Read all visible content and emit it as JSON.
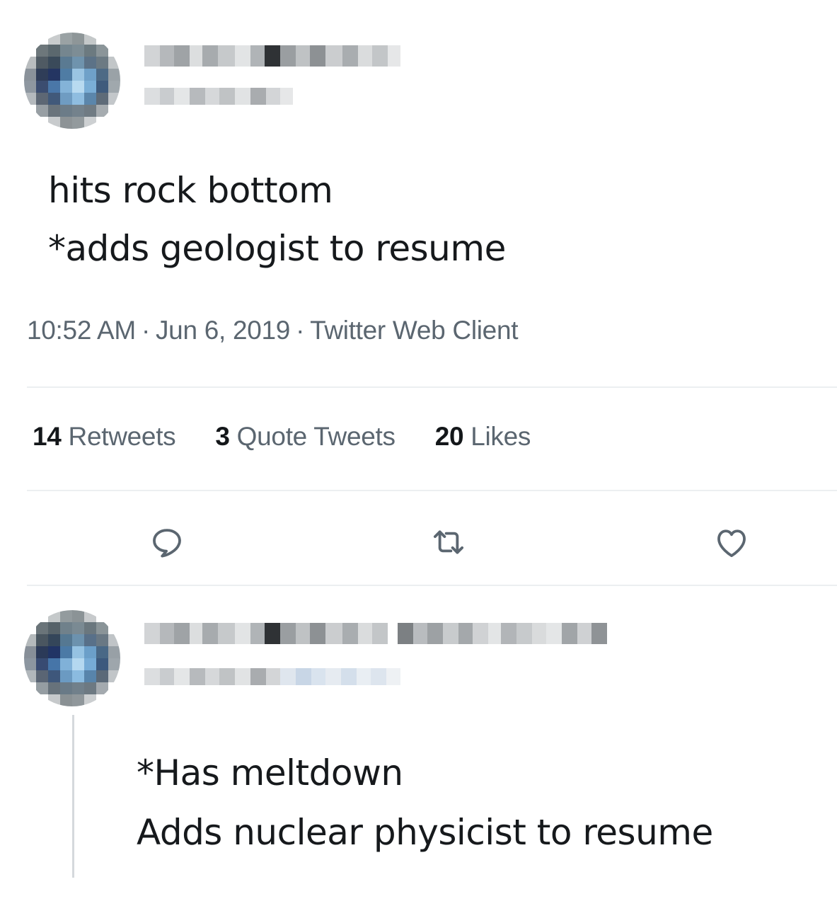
{
  "tweet": {
    "text_line1": "hits rock bottom",
    "text_line2": "*adds geologist to resume",
    "time": "10:52 AM",
    "date": "Jun 6, 2019",
    "source": "Twitter Web Client",
    "separator": "·",
    "stats": {
      "retweets_count": "14",
      "retweets_label": "Retweets",
      "quotes_count": "3",
      "quotes_label": "Quote Tweets",
      "likes_count": "20",
      "likes_label": "Likes"
    },
    "actions": {
      "reply_icon": "reply-icon",
      "retweet_icon": "retweet-icon",
      "like_icon": "heart-icon"
    }
  },
  "reply": {
    "text_line1": "*Has meltdown",
    "text_line2": "Adds nuclear physicist to resume"
  },
  "colors": {
    "text": "#14171a",
    "secondary_text": "#5b6670",
    "divider": "#eceff1",
    "redaction_dark": "#3a3d40",
    "redaction_light": "#d9dbdd"
  }
}
